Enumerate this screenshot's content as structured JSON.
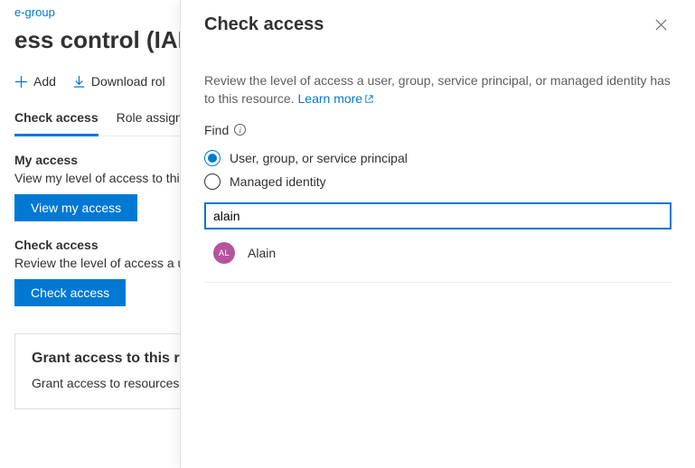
{
  "breadcrumb": "e-group",
  "page_title": "ess control (IAM)",
  "toolbar": {
    "add": "Add",
    "download": "Download rol"
  },
  "tabs": {
    "check_access": "Check access",
    "role_assign": "Role assign"
  },
  "my_access": {
    "heading": "My access",
    "desc": "View my level of access to thi",
    "button": "View my access"
  },
  "check_access": {
    "heading": "Check access",
    "desc": "Review the level of access a u",
    "button": "Check access"
  },
  "grant_card": {
    "title": "Grant access to this re",
    "desc": "Grant access to resources b"
  },
  "panel": {
    "title": "Check access",
    "desc": "Review the level of access a user, group, service principal, or managed identity has to this resource. ",
    "learn_more": "Learn more",
    "find_label": "Find",
    "opt_user": "User, group, or service principal",
    "opt_managed": "Managed identity",
    "search_value": "alain",
    "result": {
      "initials": "AL",
      "name": "Alain"
    }
  }
}
